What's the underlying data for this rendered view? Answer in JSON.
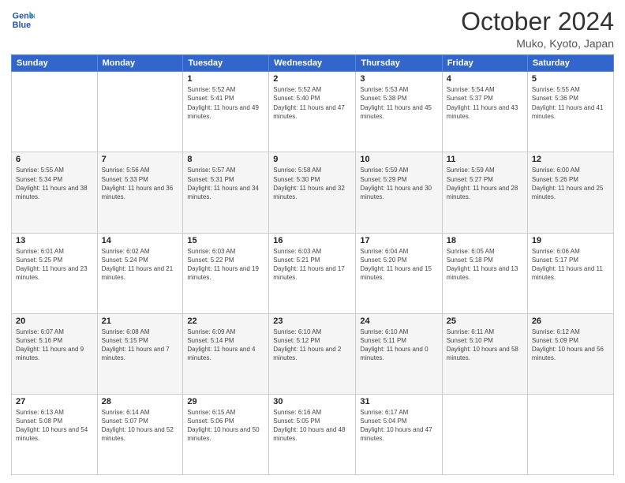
{
  "header": {
    "logo_line1": "General",
    "logo_line2": "Blue",
    "title": "October 2024",
    "subtitle": "Muko, Kyoto, Japan"
  },
  "weekdays": [
    "Sunday",
    "Monday",
    "Tuesday",
    "Wednesday",
    "Thursday",
    "Friday",
    "Saturday"
  ],
  "weeks": [
    [
      {
        "day": "",
        "info": ""
      },
      {
        "day": "",
        "info": ""
      },
      {
        "day": "1",
        "info": "Sunrise: 5:52 AM\nSunset: 5:41 PM\nDaylight: 11 hours and 49 minutes."
      },
      {
        "day": "2",
        "info": "Sunrise: 5:52 AM\nSunset: 5:40 PM\nDaylight: 11 hours and 47 minutes."
      },
      {
        "day": "3",
        "info": "Sunrise: 5:53 AM\nSunset: 5:38 PM\nDaylight: 11 hours and 45 minutes."
      },
      {
        "day": "4",
        "info": "Sunrise: 5:54 AM\nSunset: 5:37 PM\nDaylight: 11 hours and 43 minutes."
      },
      {
        "day": "5",
        "info": "Sunrise: 5:55 AM\nSunset: 5:36 PM\nDaylight: 11 hours and 41 minutes."
      }
    ],
    [
      {
        "day": "6",
        "info": "Sunrise: 5:55 AM\nSunset: 5:34 PM\nDaylight: 11 hours and 38 minutes."
      },
      {
        "day": "7",
        "info": "Sunrise: 5:56 AM\nSunset: 5:33 PM\nDaylight: 11 hours and 36 minutes."
      },
      {
        "day": "8",
        "info": "Sunrise: 5:57 AM\nSunset: 5:31 PM\nDaylight: 11 hours and 34 minutes."
      },
      {
        "day": "9",
        "info": "Sunrise: 5:58 AM\nSunset: 5:30 PM\nDaylight: 11 hours and 32 minutes."
      },
      {
        "day": "10",
        "info": "Sunrise: 5:59 AM\nSunset: 5:29 PM\nDaylight: 11 hours and 30 minutes."
      },
      {
        "day": "11",
        "info": "Sunrise: 5:59 AM\nSunset: 5:27 PM\nDaylight: 11 hours and 28 minutes."
      },
      {
        "day": "12",
        "info": "Sunrise: 6:00 AM\nSunset: 5:26 PM\nDaylight: 11 hours and 25 minutes."
      }
    ],
    [
      {
        "day": "13",
        "info": "Sunrise: 6:01 AM\nSunset: 5:25 PM\nDaylight: 11 hours and 23 minutes."
      },
      {
        "day": "14",
        "info": "Sunrise: 6:02 AM\nSunset: 5:24 PM\nDaylight: 11 hours and 21 minutes."
      },
      {
        "day": "15",
        "info": "Sunrise: 6:03 AM\nSunset: 5:22 PM\nDaylight: 11 hours and 19 minutes."
      },
      {
        "day": "16",
        "info": "Sunrise: 6:03 AM\nSunset: 5:21 PM\nDaylight: 11 hours and 17 minutes."
      },
      {
        "day": "17",
        "info": "Sunrise: 6:04 AM\nSunset: 5:20 PM\nDaylight: 11 hours and 15 minutes."
      },
      {
        "day": "18",
        "info": "Sunrise: 6:05 AM\nSunset: 5:18 PM\nDaylight: 11 hours and 13 minutes."
      },
      {
        "day": "19",
        "info": "Sunrise: 6:06 AM\nSunset: 5:17 PM\nDaylight: 11 hours and 11 minutes."
      }
    ],
    [
      {
        "day": "20",
        "info": "Sunrise: 6:07 AM\nSunset: 5:16 PM\nDaylight: 11 hours and 9 minutes."
      },
      {
        "day": "21",
        "info": "Sunrise: 6:08 AM\nSunset: 5:15 PM\nDaylight: 11 hours and 7 minutes."
      },
      {
        "day": "22",
        "info": "Sunrise: 6:09 AM\nSunset: 5:14 PM\nDaylight: 11 hours and 4 minutes."
      },
      {
        "day": "23",
        "info": "Sunrise: 6:10 AM\nSunset: 5:12 PM\nDaylight: 11 hours and 2 minutes."
      },
      {
        "day": "24",
        "info": "Sunrise: 6:10 AM\nSunset: 5:11 PM\nDaylight: 11 hours and 0 minutes."
      },
      {
        "day": "25",
        "info": "Sunrise: 6:11 AM\nSunset: 5:10 PM\nDaylight: 10 hours and 58 minutes."
      },
      {
        "day": "26",
        "info": "Sunrise: 6:12 AM\nSunset: 5:09 PM\nDaylight: 10 hours and 56 minutes."
      }
    ],
    [
      {
        "day": "27",
        "info": "Sunrise: 6:13 AM\nSunset: 5:08 PM\nDaylight: 10 hours and 54 minutes."
      },
      {
        "day": "28",
        "info": "Sunrise: 6:14 AM\nSunset: 5:07 PM\nDaylight: 10 hours and 52 minutes."
      },
      {
        "day": "29",
        "info": "Sunrise: 6:15 AM\nSunset: 5:06 PM\nDaylight: 10 hours and 50 minutes."
      },
      {
        "day": "30",
        "info": "Sunrise: 6:16 AM\nSunset: 5:05 PM\nDaylight: 10 hours and 48 minutes."
      },
      {
        "day": "31",
        "info": "Sunrise: 6:17 AM\nSunset: 5:04 PM\nDaylight: 10 hours and 47 minutes."
      },
      {
        "day": "",
        "info": ""
      },
      {
        "day": "",
        "info": ""
      }
    ]
  ]
}
